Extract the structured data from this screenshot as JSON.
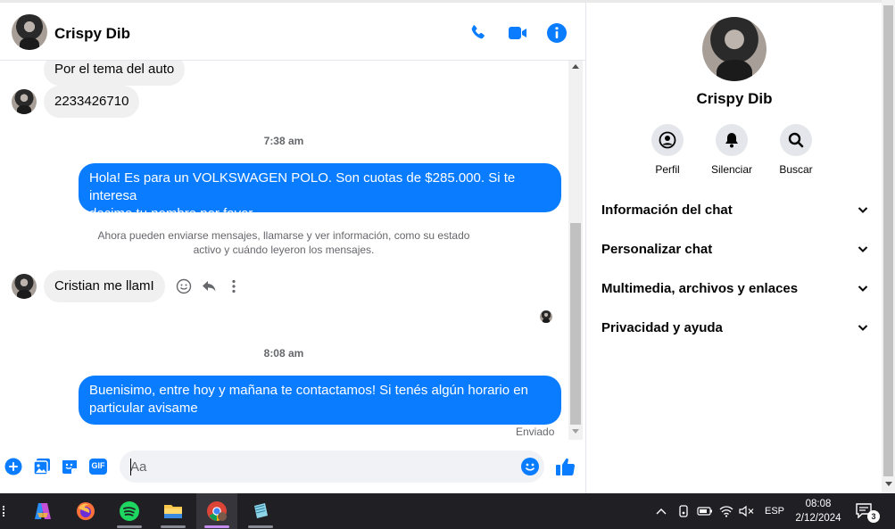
{
  "header": {
    "contact_name": "Crispy Dib"
  },
  "messages": {
    "in_1": "Por el tema del auto",
    "in_2": "2233426710",
    "time_1": "7:38 am",
    "out_1_line1": "Hola! Es para un VOLKSWAGEN POLO. Son cuotas de $285.000. Si te interesa",
    "out_1_line2": "decime tu nombre por favor",
    "system_line1": "Ahora pueden enviarse mensajes, llamarse y ver información, como su estado",
    "system_line2": "activo y cuándo leyeron los mensajes.",
    "in_3": "Cristian me llamI",
    "time_2": "8:08 am",
    "out_2_line1": "Buenisimo, entre hoy y mañana te contactamos! Si tenés algún horario en",
    "out_2_line2": "particular avisame",
    "status": "Enviado"
  },
  "composer": {
    "placeholder": "Aa",
    "gif_label": "GIF"
  },
  "panel": {
    "name": "Crispy Dib",
    "actions": [
      "Perfil",
      "Silenciar",
      "Buscar"
    ],
    "sections": [
      "Información del chat",
      "Personalizar chat",
      "Multimedia, archivos y enlaces",
      "Privacidad y ayuda"
    ]
  },
  "taskbar": {
    "language": "ESP",
    "time": "08:08",
    "date": "2/12/2024",
    "notification_count": "3"
  },
  "colors": {
    "accent": "#0a7cff",
    "bubble_in": "#f0f0f0",
    "taskbar": "#1f1f24"
  }
}
